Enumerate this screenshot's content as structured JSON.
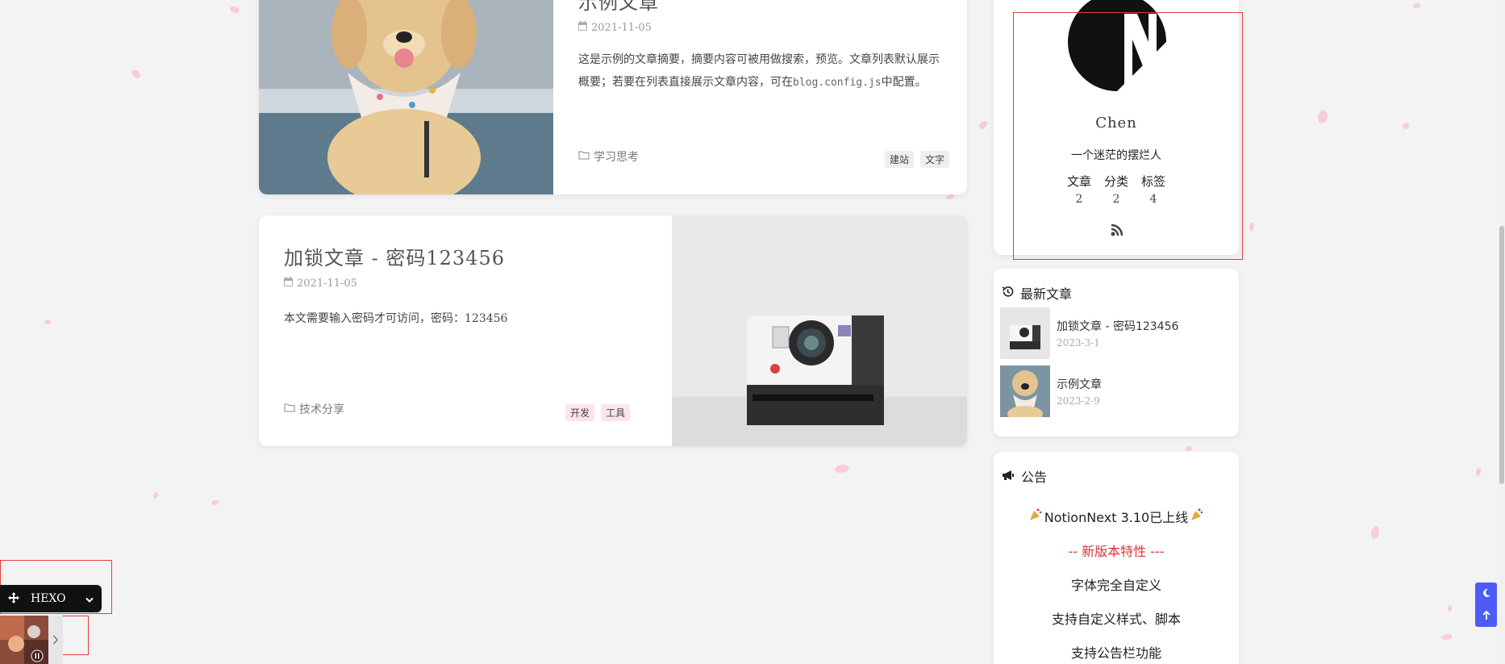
{
  "posts": [
    {
      "title": "示例文章",
      "date": "2021-11-05",
      "summary_pre": "这是示例的文章摘要，摘要内容可被用做搜索，预览。文章列表默认展示概要；若要在列表直接展示文章内容，可在",
      "summary_code": "blog.config.js",
      "summary_post": "中配置。",
      "category": "学习思考",
      "tags": [
        "建站",
        "文字"
      ]
    },
    {
      "title": "加锁文章 - 密码123456",
      "date": "2021-11-05",
      "summary": "本文需要输入密码才可访问，密码：123456",
      "category": "技术分享",
      "tags": [
        "开发",
        "工具"
      ]
    }
  ],
  "profile": {
    "name": "Chen",
    "bio": "一个迷茫的摆烂人",
    "stats": [
      {
        "label": "文章",
        "value": "2"
      },
      {
        "label": "分类",
        "value": "2"
      },
      {
        "label": "标签",
        "value": "4"
      }
    ],
    "rss_icon": "rss-icon"
  },
  "latest": {
    "title": "最新文章",
    "items": [
      {
        "title": "加锁文章 - 密码123456",
        "date": "2023-3-1"
      },
      {
        "title": "示例文章",
        "date": "2023-2-9"
      }
    ]
  },
  "notice": {
    "title": "公告",
    "headline": "NotionNext 3.10已上线",
    "subhead": "-- 新版本特性 ---",
    "lines": [
      "字体完全自定义",
      "支持自定义样式、脚本",
      "支持公告栏功能"
    ]
  },
  "theme_switcher": {
    "label": "HEXO"
  },
  "colors": {
    "accent": "#4f5bf7",
    "tag_gray": "#eeeeee",
    "tag_pink": "#fce4ee",
    "red": "#d9363e"
  }
}
